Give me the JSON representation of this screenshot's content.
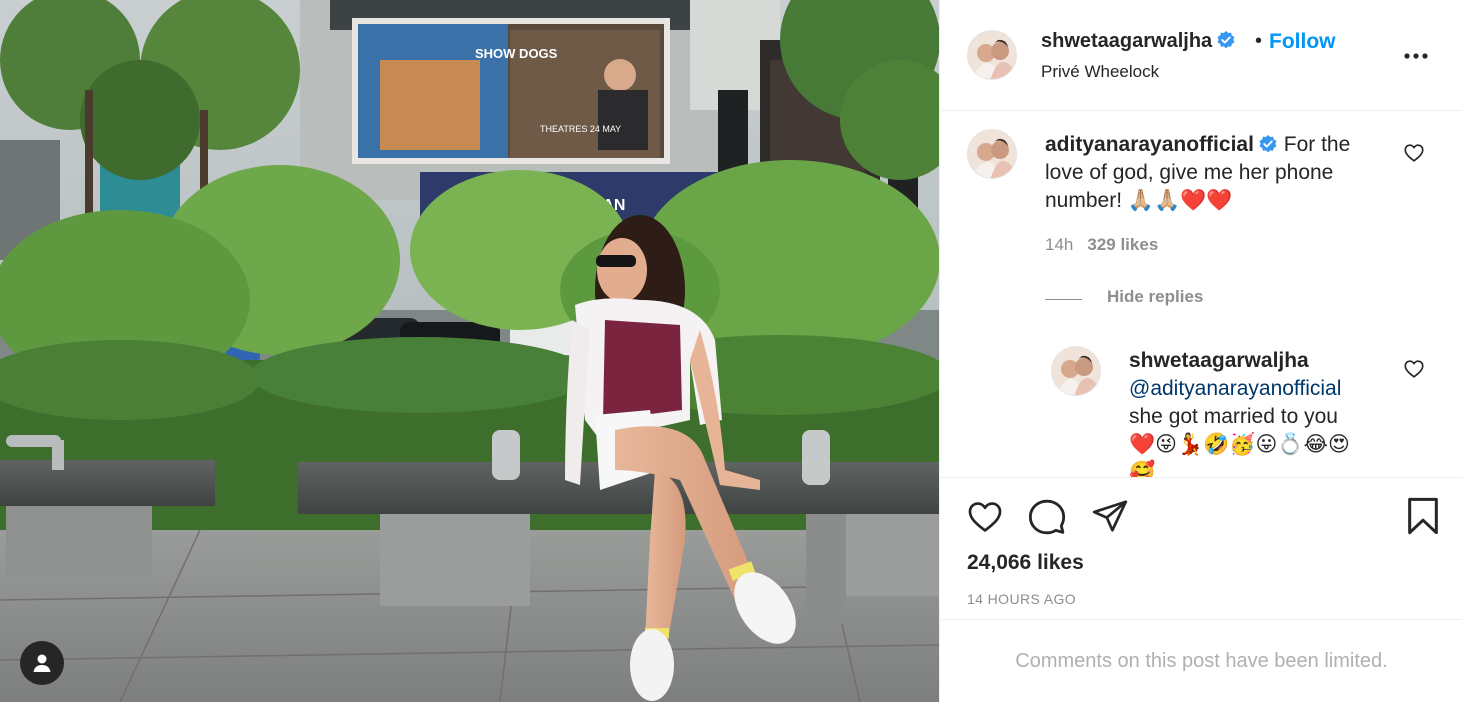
{
  "post": {
    "author": "shwetaagarwaljha",
    "separator": "•",
    "follow_label": "Follow",
    "location": "Privé Wheelock",
    "likes": "24,066 likes",
    "time_ago": "14 HOURS AGO",
    "comments_notice": "Comments on this post have been limited."
  },
  "photo": {
    "billboard_title": "SHOW DOGS",
    "billboard_date": "THEATRES 24 MAY",
    "store_sign": "ISETAN"
  },
  "comment": {
    "username": "adityanarayanofficial",
    "text": "For the love of god, give me her phone number! 🙏🏼🙏🏼❤️❤️",
    "time": "14h",
    "likes": "329 likes"
  },
  "replies_toggle": "Hide replies",
  "reply": {
    "username": "shwetaagarwaljha",
    "mention": "@adityanarayanofficial",
    "text": "she got married to you",
    "emojis": "❤️😜💃🤣🥳😛💍😂😍🥰"
  },
  "icons": {
    "verified": "verified-badge-icon",
    "more": "more-options-icon",
    "like": "heart-icon",
    "comment": "comment-icon",
    "share": "share-icon",
    "save": "bookmark-icon",
    "tag": "user-tag-icon"
  },
  "colors": {
    "accent": "#0095f6",
    "verified": "#3897f0",
    "muted": "#8e8e8e",
    "text": "#262626",
    "mention": "#00376b"
  }
}
